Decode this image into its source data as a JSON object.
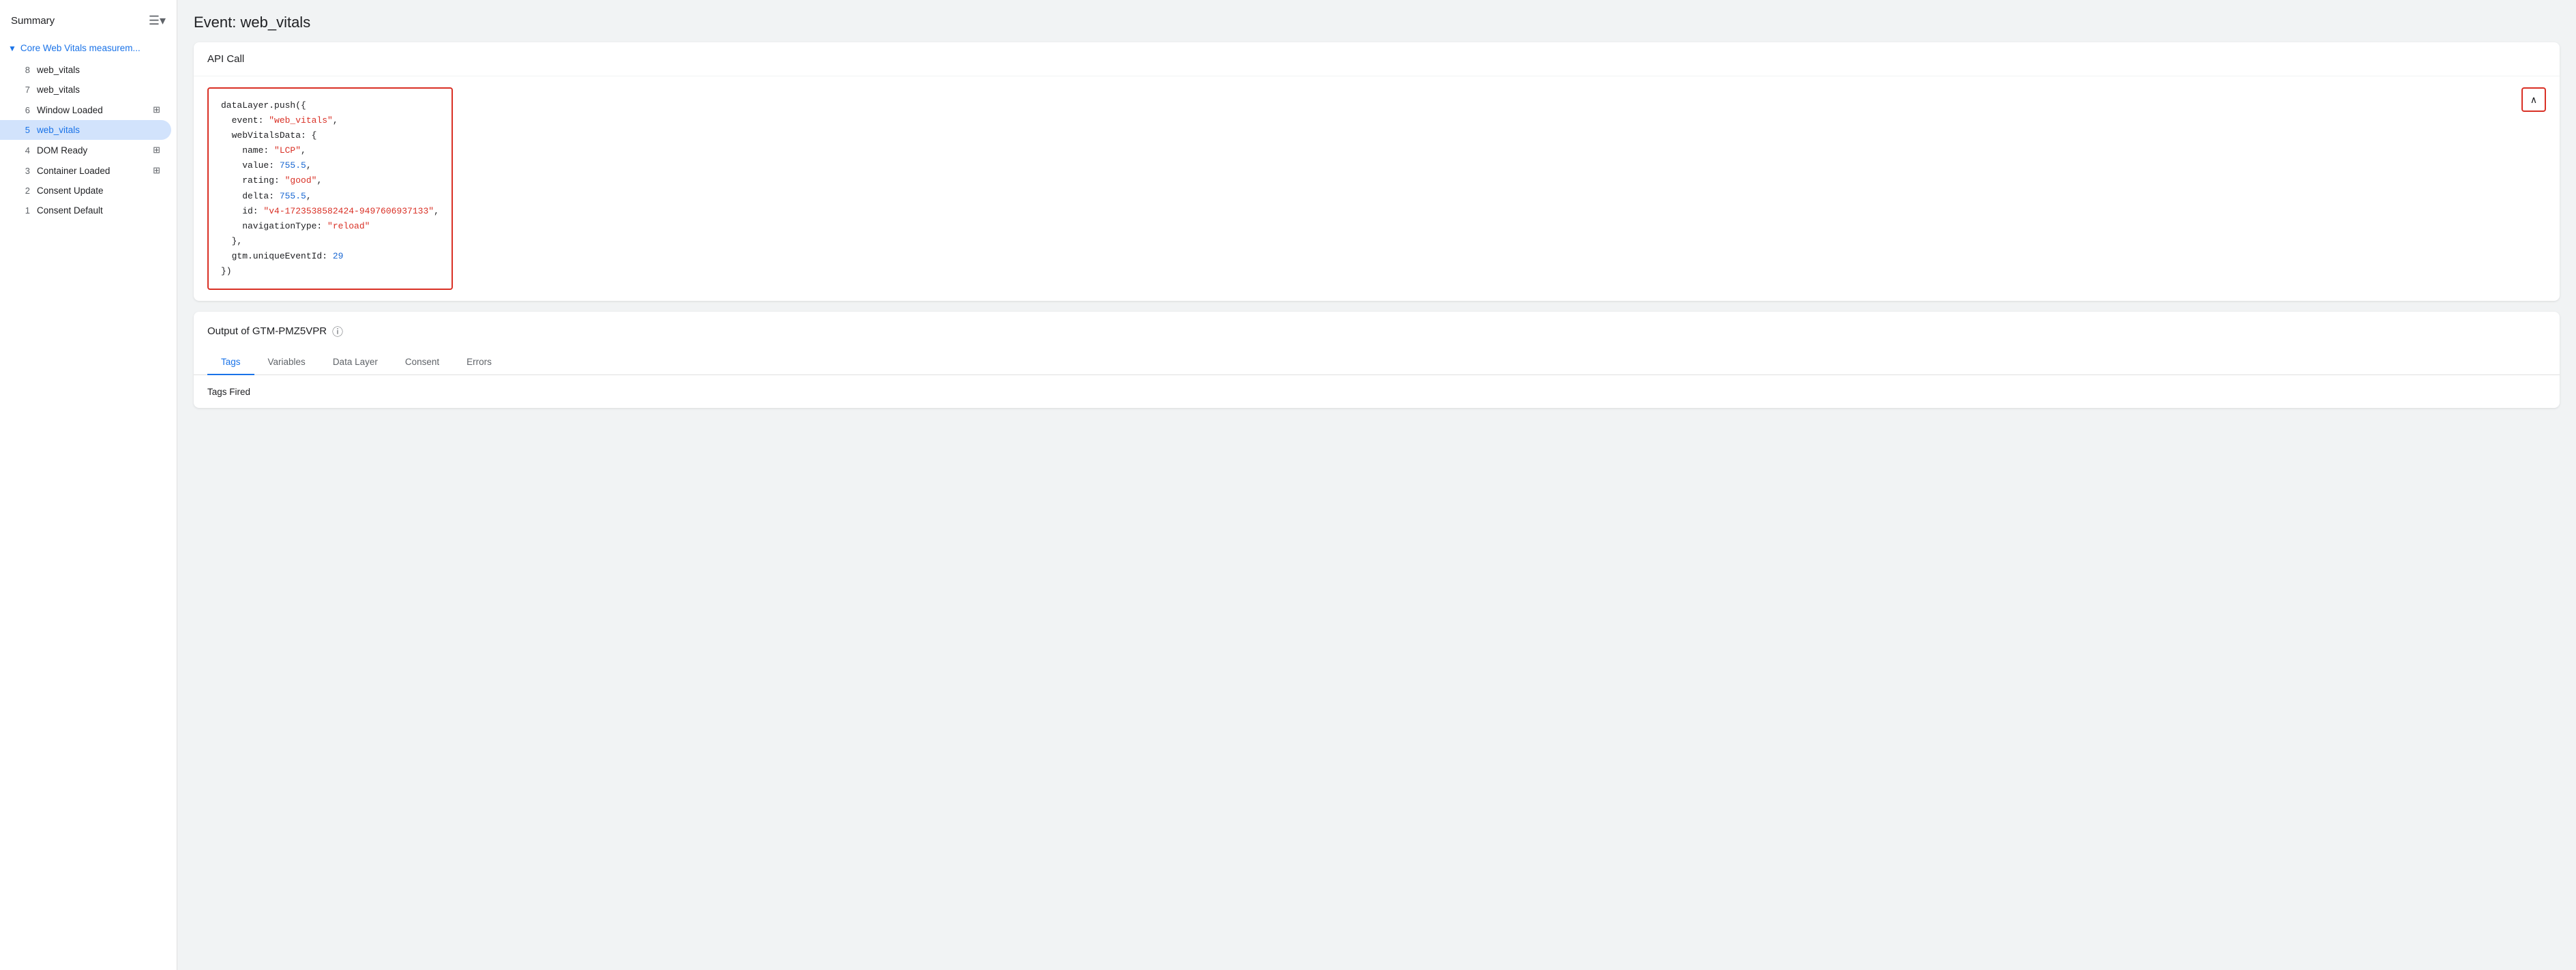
{
  "sidebar": {
    "title": "Summary",
    "header_icon": "☰",
    "group": {
      "chevron": "▼",
      "label": "Core Web Vitals measurem..."
    },
    "items": [
      {
        "number": "8",
        "label": "web_vitals",
        "icon": null,
        "active": false
      },
      {
        "number": "7",
        "label": "web_vitals",
        "icon": null,
        "active": false
      },
      {
        "number": "6",
        "label": "Window Loaded",
        "icon": "⊞",
        "active": false
      },
      {
        "number": "5",
        "label": "web_vitals",
        "icon": null,
        "active": true
      },
      {
        "number": "4",
        "label": "DOM Ready",
        "icon": "⊞",
        "active": false
      },
      {
        "number": "3",
        "label": "Container Loaded",
        "icon": "⊞",
        "active": false
      },
      {
        "number": "2",
        "label": "Consent Update",
        "icon": null,
        "active": false
      },
      {
        "number": "1",
        "label": "Consent Default",
        "icon": null,
        "active": false
      }
    ]
  },
  "main": {
    "page_title": "Event: web_vitals",
    "api_call": {
      "header": "API Call",
      "code_lines": [
        {
          "text": "dataLayer.push({",
          "type": "plain"
        },
        {
          "text": "  event: ",
          "type": "plain",
          "value": "\"web_vitals\"",
          "value_type": "string",
          "suffix": ","
        },
        {
          "text": "  webVitalsData: {",
          "type": "plain"
        },
        {
          "text": "    name: ",
          "type": "plain",
          "value": "\"LCP\"",
          "value_type": "string",
          "suffix": ","
        },
        {
          "text": "    value: ",
          "type": "plain",
          "value": "755.5",
          "value_type": "number",
          "suffix": ","
        },
        {
          "text": "    rating: ",
          "type": "plain",
          "value": "\"good\"",
          "value_type": "string",
          "suffix": ","
        },
        {
          "text": "    delta: ",
          "type": "plain",
          "value": "755.5",
          "value_type": "number",
          "suffix": ","
        },
        {
          "text": "    id: ",
          "type": "plain",
          "value": "\"v4-1723538582424-9497606937133\"",
          "value_type": "string",
          "suffix": ","
        },
        {
          "text": "    navigationType: ",
          "type": "plain",
          "value": "\"reload\"",
          "value_type": "string"
        },
        {
          "text": "  },",
          "type": "plain"
        },
        {
          "text": "  gtm.uniqueEventId: ",
          "type": "plain",
          "value": "29",
          "value_type": "number"
        },
        {
          "text": "})",
          "type": "plain"
        }
      ],
      "collapse_icon": "∧"
    },
    "output": {
      "header": "Output of GTM-PMZ5VPR",
      "help_icon": "?",
      "tabs": [
        {
          "label": "Tags",
          "active": true
        },
        {
          "label": "Variables",
          "active": false
        },
        {
          "label": "Data Layer",
          "active": false
        },
        {
          "label": "Consent",
          "active": false
        },
        {
          "label": "Errors",
          "active": false
        }
      ],
      "tags_fired_label": "Tags Fired"
    }
  },
  "colors": {
    "accent_blue": "#1a73e8",
    "red_border": "#d93025",
    "string_color": "#d93025",
    "number_color": "#1967d2",
    "active_bg": "#d2e3fc"
  }
}
